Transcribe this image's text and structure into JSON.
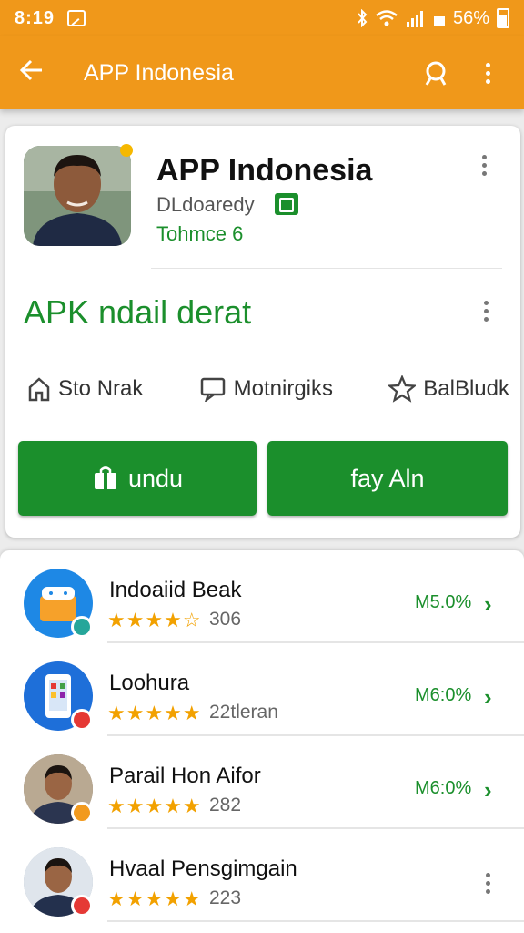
{
  "status": {
    "time": "8:19",
    "battery": "56%"
  },
  "appbar": {
    "title": "APP Indonesia"
  },
  "app": {
    "title": "APP Indonesia",
    "developer": "DLdoaredy",
    "category": "Tohmce 6",
    "tagline": "APK ndail derat",
    "stats": [
      "Sto Nrak",
      "Motnirgiks",
      "BalBludk"
    ]
  },
  "buttons": {
    "install": "undu",
    "play": "fay Aln"
  },
  "list": [
    {
      "name": "Indoaiid Beak",
      "stars": "★★★★☆",
      "rating": "306",
      "size": "M5.0%",
      "end": "chevron",
      "icon": "app-icon-food",
      "color": "#1e88e5",
      "mini": "#26a69a"
    },
    {
      "name": "Loohura",
      "stars": "★★★★★",
      "rating": "22tleran",
      "size": "M6:0%",
      "end": "chevron",
      "icon": "app-icon-phone",
      "color": "#1e6fd9",
      "mini": "#e53935"
    },
    {
      "name": "Parail Hon Aifor",
      "stars": "★★★★★",
      "rating": "282",
      "size": "M6:0%",
      "end": "chevron",
      "icon": "avatar-man",
      "color": "#8a7a6a",
      "mini": "#f29a1e"
    },
    {
      "name": "Hvaal Pensgimgain",
      "stars": "★★★★★",
      "rating": "223",
      "size": "",
      "end": "more",
      "icon": "avatar-man",
      "color": "#9aa8b8",
      "mini": "#e53935"
    }
  ],
  "colors": {
    "accent": "#f0981a",
    "primary": "#1b8f2c",
    "star": "#f2a100"
  }
}
